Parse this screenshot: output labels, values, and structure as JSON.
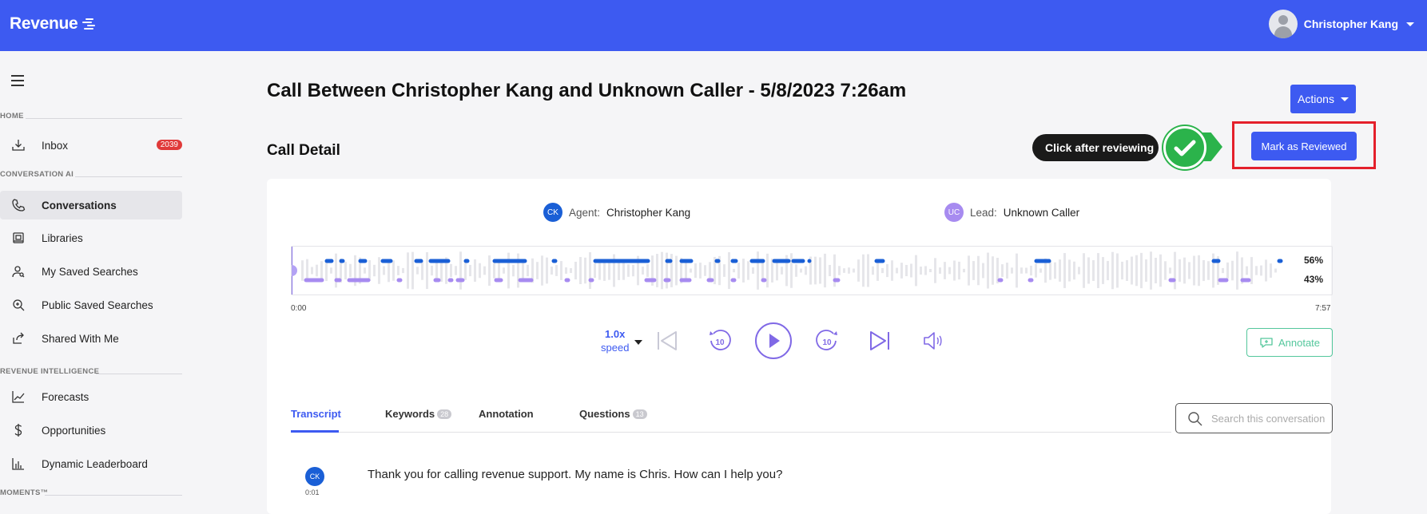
{
  "topbar": {
    "brand": "Revenue",
    "user_name": "Christopher Kang"
  },
  "sidebar": {
    "sections": [
      {
        "label": "HOME"
      },
      {
        "label": "CONVERSATION AI"
      },
      {
        "label": "REVENUE INTELLIGENCE"
      },
      {
        "label": "MOMENTS™"
      }
    ],
    "items": [
      {
        "label": "Inbox",
        "icon": "inbox-icon",
        "badge": "2039"
      },
      {
        "label": "Conversations",
        "icon": "phone-icon",
        "active": true
      },
      {
        "label": "Libraries",
        "icon": "library-icon"
      },
      {
        "label": "My Saved Searches",
        "icon": "user-search-icon"
      },
      {
        "label": "Public Saved Searches",
        "icon": "search-plus-icon"
      },
      {
        "label": "Shared With Me",
        "icon": "share-icon"
      },
      {
        "label": "Forecasts",
        "icon": "line-chart-icon"
      },
      {
        "label": "Opportunities",
        "icon": "dollar-icon"
      },
      {
        "label": "Dynamic Leaderboard",
        "icon": "bar-chart-icon"
      }
    ]
  },
  "main": {
    "title": "Call Between Christopher Kang and Unknown Caller - 5/8/2023 7:26am",
    "section_title": "Call Detail",
    "actions_label": "Actions",
    "mark_reviewed_label": "Mark as Reviewed",
    "hint_label": "Click after reviewing"
  },
  "call": {
    "agent": {
      "initials": "CK",
      "key": "Agent:",
      "name": "Christopher Kang",
      "color": "#1a5fd6"
    },
    "lead": {
      "initials": "UC",
      "key": "Lead:",
      "name": "Unknown Caller",
      "color": "#a78bf0"
    },
    "agent_talk_pct": "56%",
    "lead_talk_pct": "43%",
    "time_start": "0:00",
    "time_end": "7:57",
    "playback_position": 0
  },
  "player": {
    "speed_value": "1.0x",
    "speed_label": "speed",
    "skip_back_seconds": "10",
    "skip_forward_seconds": "10",
    "annotate_label": "Annotate"
  },
  "tabs": [
    {
      "label": "Transcript",
      "active": true
    },
    {
      "label": "Keywords",
      "count": "28"
    },
    {
      "label": "Annotation"
    },
    {
      "label": "Questions",
      "count": "13"
    }
  ],
  "search": {
    "placeholder": "Search this conversation"
  },
  "transcript": [
    {
      "initials": "CK",
      "time": "0:01",
      "text": "Thank you for calling revenue support. My name is Chris. How can I help you?"
    }
  ],
  "colors": {
    "accent": "#3d5af1",
    "agent": "#1a5fd6",
    "lead": "#a78bf0",
    "highlight": "#e4202b",
    "hint_green": "#2bb34b"
  }
}
